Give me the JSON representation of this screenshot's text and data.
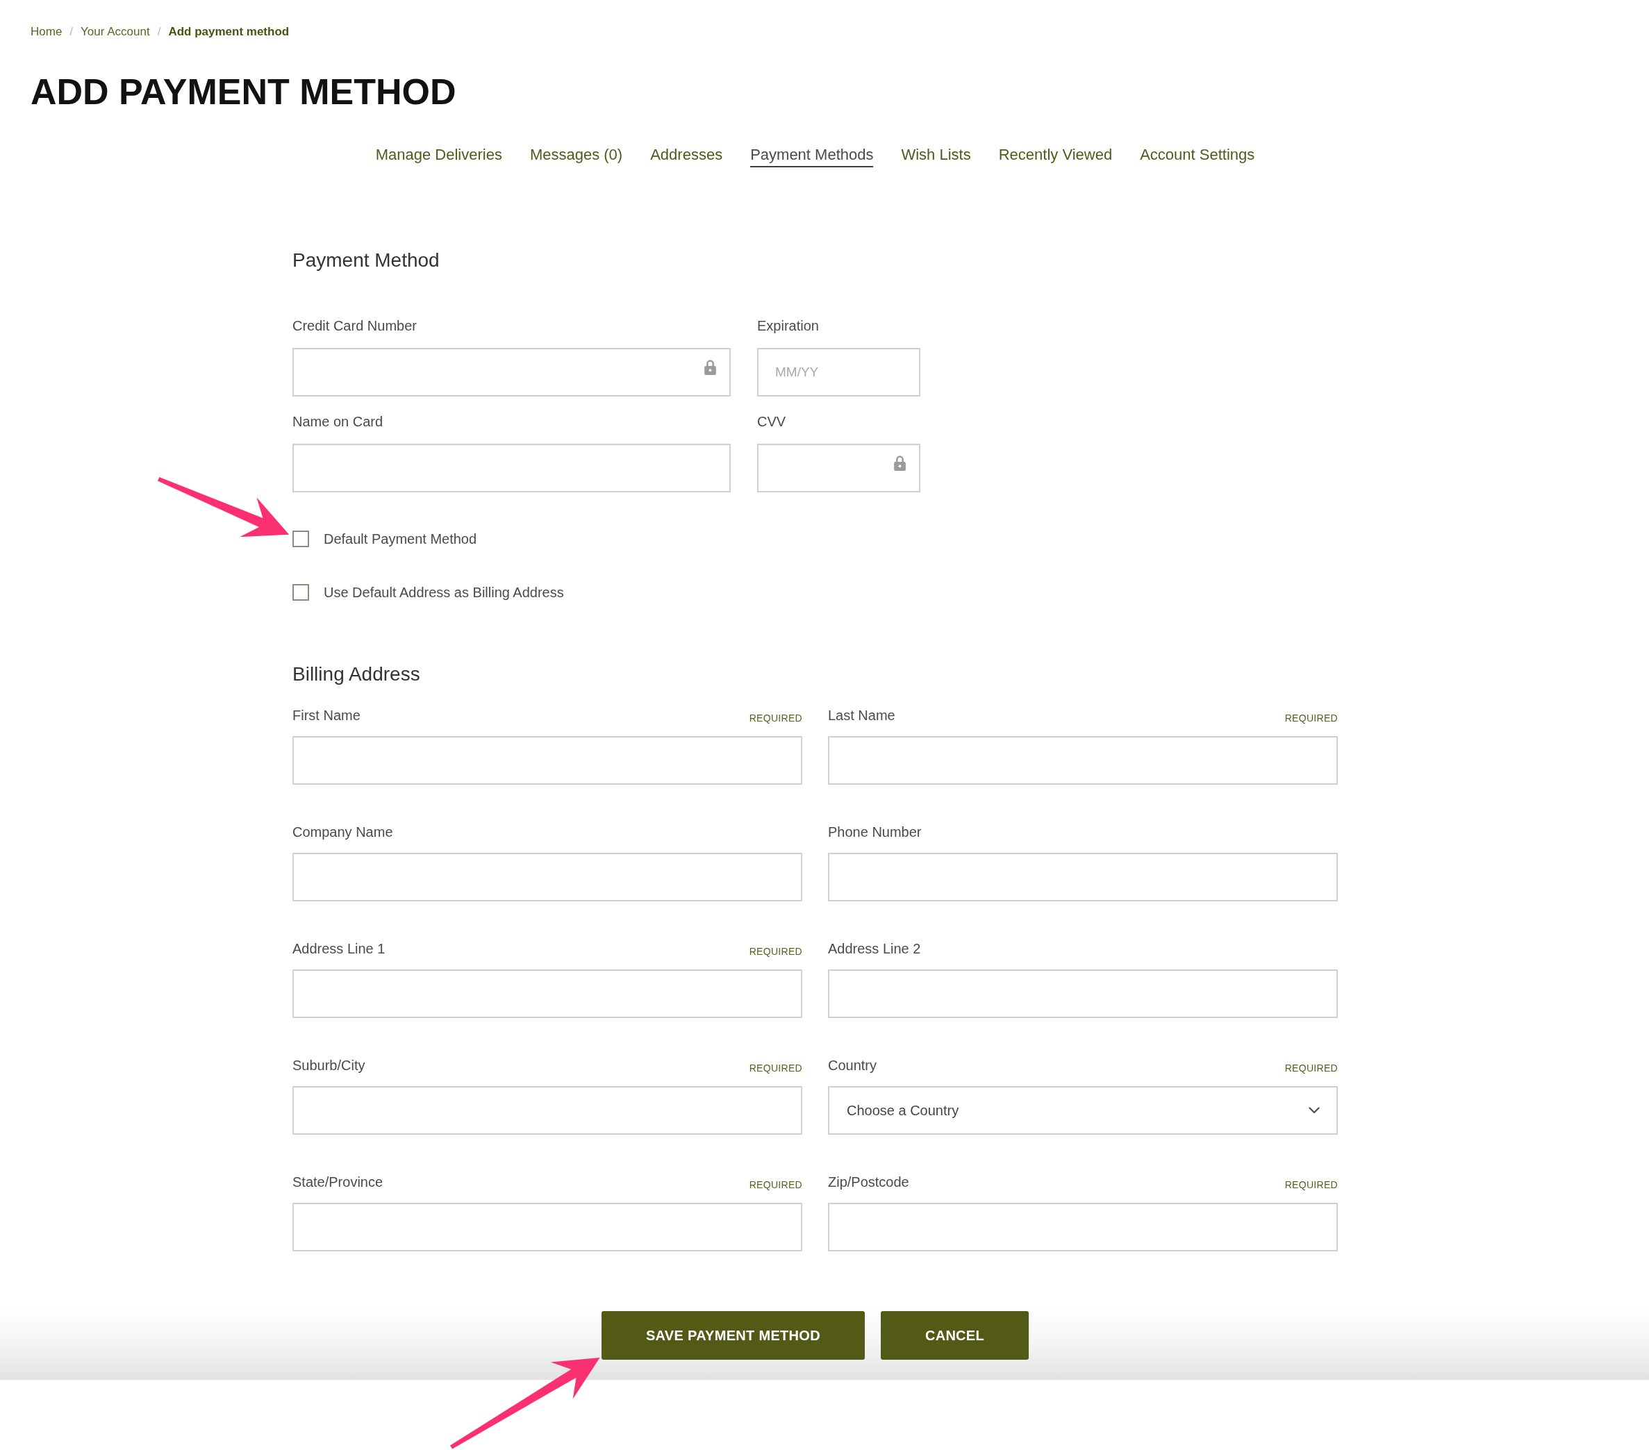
{
  "breadcrumb": [
    {
      "label": "Home",
      "current": false
    },
    {
      "separator": "/",
      "label": "Your Account",
      "current": false
    },
    {
      "separator": "/",
      "label": "Add payment method",
      "current": true
    }
  ],
  "title": "ADD PAYMENT METHOD",
  "tabs": [
    {
      "label": "Manage Deliveries",
      "selected": false
    },
    {
      "label": "Messages (0)",
      "selected": false
    },
    {
      "label": "Addresses",
      "selected": false
    },
    {
      "label": "Payment Methods",
      "selected": true
    },
    {
      "label": "Wish Lists",
      "selected": false
    },
    {
      "label": "Recently Viewed",
      "selected": false
    },
    {
      "label": "Account Settings",
      "selected": false
    }
  ],
  "payment_method": {
    "heading": "Payment Method",
    "fields": [
      {
        "label": "Credit Card Number",
        "secure": true
      },
      {
        "label": "Expiration",
        "placeholder": "MM/YY",
        "secure": false
      },
      {
        "label": "Name on Card",
        "secure": false
      },
      {
        "label": "CVV",
        "secure": true
      }
    ],
    "checkboxes": [
      {
        "label": "Default Payment Method",
        "checked": false
      },
      {
        "label": "Use Default Address as Billing Address",
        "checked": false
      }
    ]
  },
  "billing_address": {
    "heading": "Billing Address",
    "fields": [
      {
        "kind": "text",
        "label": "First Name",
        "required": "REQUIRED"
      },
      {
        "kind": "text",
        "label": "Last Name",
        "required": "REQUIRED"
      },
      {
        "kind": "text",
        "label": "Company Name"
      },
      {
        "kind": "text",
        "label": "Phone Number"
      },
      {
        "kind": "text",
        "label": "Address Line 1",
        "required": "REQUIRED"
      },
      {
        "kind": "text",
        "label": "Address Line 2"
      },
      {
        "kind": "text",
        "label": "Suburb/City",
        "required": "REQUIRED"
      },
      {
        "kind": "select",
        "label": "Country",
        "required": "REQUIRED",
        "value": "Choose a Country"
      },
      {
        "kind": "text",
        "label": "State/Province",
        "required": "REQUIRED"
      },
      {
        "kind": "text",
        "label": "Zip/Postcode",
        "required": "REQUIRED"
      }
    ]
  },
  "buttons": [
    {
      "label": "SAVE PAYMENT METHOD"
    },
    {
      "label": "CANCEL"
    }
  ]
}
